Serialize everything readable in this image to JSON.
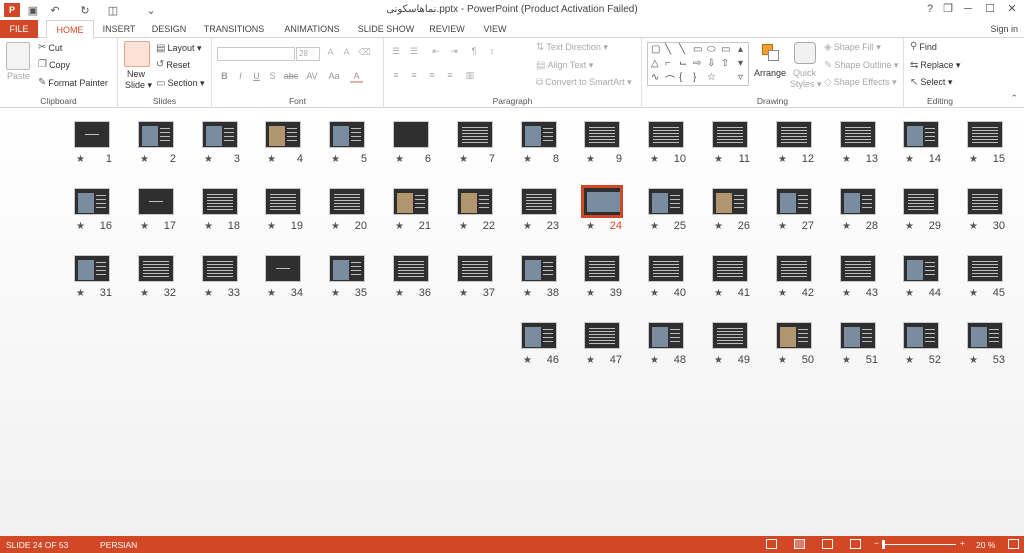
{
  "window": {
    "title": "نماهاسکونی.pptx - PowerPoint (Product Activation Failed)",
    "help": "?",
    "restore": "❐",
    "minimize": "─",
    "maximize": "☐",
    "close": "✕"
  },
  "qat": {
    "app_icon": "P",
    "save": "▣",
    "undo": "↶",
    "redo": "↻",
    "present": "◫",
    "customize": "⌄"
  },
  "tabs": [
    "FILE",
    "HOME",
    "INSERT",
    "DESIGN",
    "TRANSITIONS",
    "ANIMATIONS",
    "SLIDE SHOW",
    "REVIEW",
    "VIEW"
  ],
  "sign_in": "Sign in",
  "ribbon": {
    "clipboard": {
      "label": "Clipboard",
      "paste": "Paste",
      "cut": "Cut",
      "copy": "Copy",
      "format_painter": "Format Painter"
    },
    "slides": {
      "label": "Slides",
      "new_slide_1": "New",
      "new_slide_2": "Slide ▾",
      "layout": "Layout ▾",
      "reset": "Reset",
      "section": "Section ▾"
    },
    "font": {
      "label": "Font",
      "size": "28",
      "buttons": [
        "B",
        "I",
        "U",
        "S",
        "abc",
        "AV",
        "Aa",
        "A"
      ]
    },
    "paragraph": {
      "label": "Paragraph",
      "text_direction": "Text Direction ▾",
      "align_text": "Align Text ▾",
      "convert": "Convert to SmartArt ▾"
    },
    "drawing": {
      "label": "Drawing",
      "arrange": "Arrange",
      "quick_styles_1": "Quick",
      "quick_styles_2": "Styles ▾",
      "shape_fill": "Shape Fill ▾",
      "shape_outline": "Shape Outline ▾",
      "shape_effects": "Shape Effects ▾"
    },
    "editing": {
      "label": "Editing",
      "find": "Find",
      "replace": "Replace ▾",
      "select": "Select ▾"
    }
  },
  "slides": [
    {
      "n": "15",
      "t": "text"
    },
    {
      "n": "14",
      "t": "photo"
    },
    {
      "n": "13",
      "t": "text"
    },
    {
      "n": "12",
      "t": "text"
    },
    {
      "n": "11",
      "t": "text"
    },
    {
      "n": "10",
      "t": "text"
    },
    {
      "n": "9",
      "t": "text"
    },
    {
      "n": "8",
      "t": "photo"
    },
    {
      "n": "7",
      "t": "text"
    },
    {
      "n": "6",
      "t": "blank"
    },
    {
      "n": "5",
      "t": "photo"
    },
    {
      "n": "4",
      "t": "photo2"
    },
    {
      "n": "3",
      "t": "photo"
    },
    {
      "n": "2",
      "t": "photo"
    },
    {
      "n": "1",
      "t": "title"
    },
    {
      "n": "30",
      "t": "text"
    },
    {
      "n": "29",
      "t": "text"
    },
    {
      "n": "28",
      "t": "photo"
    },
    {
      "n": "27",
      "t": "photo"
    },
    {
      "n": "26",
      "t": "photo2"
    },
    {
      "n": "25",
      "t": "photo"
    },
    {
      "n": "24",
      "t": "photo",
      "sel": true
    },
    {
      "n": "23",
      "t": "text"
    },
    {
      "n": "22",
      "t": "photo2"
    },
    {
      "n": "21",
      "t": "photo2"
    },
    {
      "n": "20",
      "t": "text"
    },
    {
      "n": "19",
      "t": "text"
    },
    {
      "n": "18",
      "t": "text"
    },
    {
      "n": "17",
      "t": "title"
    },
    {
      "n": "16",
      "t": "photo"
    },
    {
      "n": "45",
      "t": "text"
    },
    {
      "n": "44",
      "t": "photo"
    },
    {
      "n": "43",
      "t": "text"
    },
    {
      "n": "42",
      "t": "text"
    },
    {
      "n": "41",
      "t": "text"
    },
    {
      "n": "40",
      "t": "text"
    },
    {
      "n": "39",
      "t": "text"
    },
    {
      "n": "38",
      "t": "photo"
    },
    {
      "n": "37",
      "t": "text"
    },
    {
      "n": "36",
      "t": "text"
    },
    {
      "n": "35",
      "t": "photo"
    },
    {
      "n": "34",
      "t": "title"
    },
    {
      "n": "33",
      "t": "text"
    },
    {
      "n": "32",
      "t": "text"
    },
    {
      "n": "31",
      "t": "photo"
    },
    {
      "n": "53",
      "t": "photo"
    },
    {
      "n": "52",
      "t": "photo"
    },
    {
      "n": "51",
      "t": "photo"
    },
    {
      "n": "50",
      "t": "photo2"
    },
    {
      "n": "49",
      "t": "text"
    },
    {
      "n": "48",
      "t": "photo"
    },
    {
      "n": "47",
      "t": "text"
    },
    {
      "n": "46",
      "t": "photo"
    }
  ],
  "star_glyph": "★",
  "status": {
    "slide_info": "SLIDE 24 OF 53",
    "language": "PERSIAN",
    "zoom": "20 %",
    "zoom_minus": "−",
    "zoom_plus": "+"
  }
}
